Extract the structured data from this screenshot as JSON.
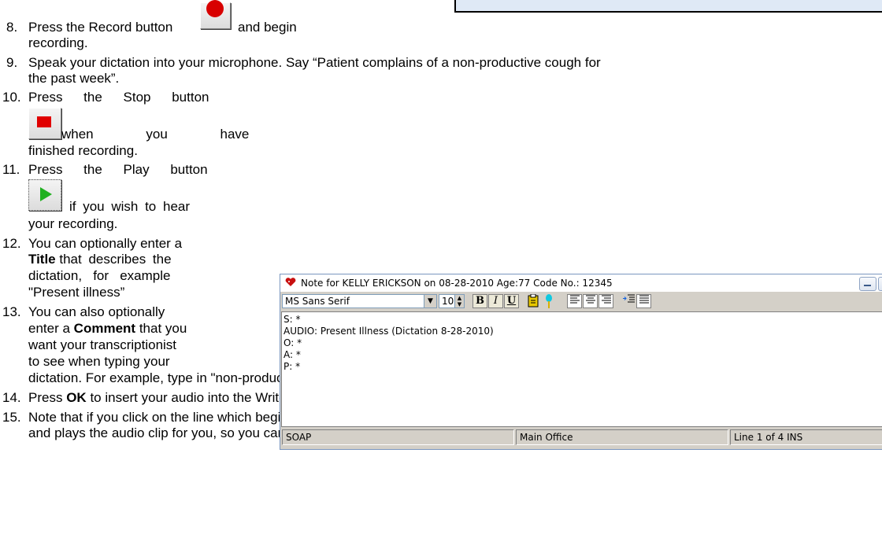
{
  "steps": [
    {
      "n": "8.",
      "text_a": "Press the Record button",
      "text_b": "and begin",
      "cont": "recording."
    },
    {
      "n": "9.",
      "text": "Speak your dictation into your microphone. Say “Patient complains of a non-productive cough for",
      "cont": "the past week”."
    },
    {
      "n": "10.",
      "a": "Press the Stop button",
      "b": "when you have",
      "c": "finished recording."
    },
    {
      "n": "11.",
      "a": "Press the Play button",
      "b": "if you wish to hear",
      "c": "your recording."
    },
    {
      "n": "12.",
      "a": "You can optionally enter a",
      "b_bold": "Title",
      "b_rest": "that describes the",
      "c": "dictation,   for   example",
      "d": "\"Present illness”"
    },
    {
      "n": "13.",
      "a": "You can also optionally",
      "b_pre": "enter a",
      "b_bold": "Comment",
      "b_rest": "that you",
      "c": "want your transcriptionist",
      "d": "to see when typing your",
      "e": "dictation. For example, type in \"non-productive is a hyphenated word\"."
    },
    {
      "n": "14.",
      "pre": "Press",
      "bold": "OK",
      "rest": "to insert your audio into the Writer."
    },
    {
      "n": "15.",
      "text": "Note that if you click on the line which begins “AUDIO:\", the program launches the Audio Recorder",
      "cont": "and plays the audio clip for you, so you can listen to at any time you wish."
    }
  ],
  "window": {
    "title": "Note for KELLY ERICKSON on 08-28-2010 Age:77  Code No.: 12345",
    "font_name": "MS Sans Serif",
    "font_size": "10",
    "bold_label": "B",
    "italic_label": "I",
    "underline_label": "U",
    "editor_lines": [
      "S: *",
      "AUDIO: Present Illness  (Dictation 8-28-2010)",
      "O: *",
      "A: *",
      "P: *"
    ],
    "status": [
      "SOAP",
      "Main Office",
      "Line 1 of 4  INS"
    ]
  },
  "icons": [
    "record-icon",
    "stop-icon",
    "play-icon"
  ]
}
